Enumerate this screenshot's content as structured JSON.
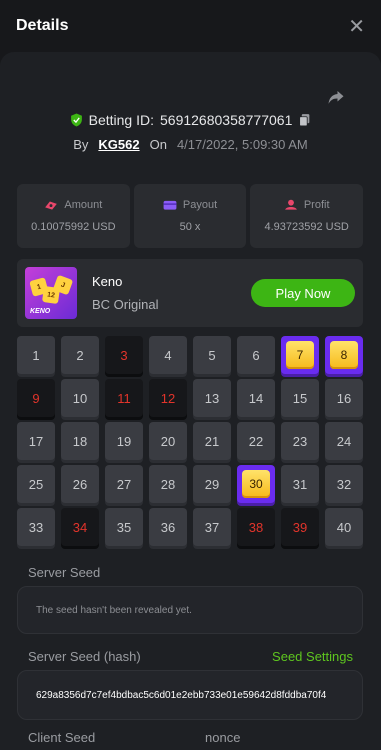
{
  "header": {
    "title": "Details",
    "close_glyph": "✕"
  },
  "bet": {
    "id_label": "Betting ID:",
    "id_value": "56912680358777061",
    "by_label": "By",
    "user": "KG562",
    "on_label": "On",
    "date": "4/17/2022, 5:09:30 AM"
  },
  "stats": [
    {
      "label": "Amount",
      "value": "0.10075992 USD",
      "icon": "money-icon",
      "color": "#e9476b"
    },
    {
      "label": "Payout",
      "value": "50 x",
      "icon": "wallet-icon",
      "color": "#8b5cf6"
    },
    {
      "label": "Profit",
      "value": "4.93723592 USD",
      "icon": "coins-icon",
      "color": "#e9476b"
    }
  ],
  "game": {
    "name": "Keno",
    "provider": "BC Original",
    "thumb_text": "KENO",
    "thumb_dice": [
      "1",
      "12",
      "J"
    ],
    "play_label": "Play Now"
  },
  "keno": {
    "numbers": [
      1,
      2,
      3,
      4,
      5,
      6,
      7,
      8,
      9,
      10,
      11,
      12,
      13,
      14,
      15,
      16,
      17,
      18,
      19,
      20,
      21,
      22,
      23,
      24,
      25,
      26,
      27,
      28,
      29,
      30,
      31,
      32,
      33,
      34,
      35,
      36,
      37,
      38,
      39,
      40
    ],
    "hits": [
      7,
      8,
      30
    ],
    "misses": [
      3,
      9,
      11,
      12,
      34,
      38,
      39
    ]
  },
  "server_seed": {
    "label": "Server Seed",
    "note": "The seed hasn't been revealed yet."
  },
  "server_seed_hash": {
    "label": "Server Seed (hash)",
    "settings_link": "Seed Settings",
    "value": "629a8356d7c7ef4bdbac5c6d01e2ebb733e01e59642d8fddba70f4"
  },
  "client_seed": {
    "label": "Client Seed",
    "nonce_label": "nonce"
  },
  "colors": {
    "accent_green": "#3db514",
    "hit_purple": "#6a2cf0",
    "miss_red": "#e2342b"
  }
}
